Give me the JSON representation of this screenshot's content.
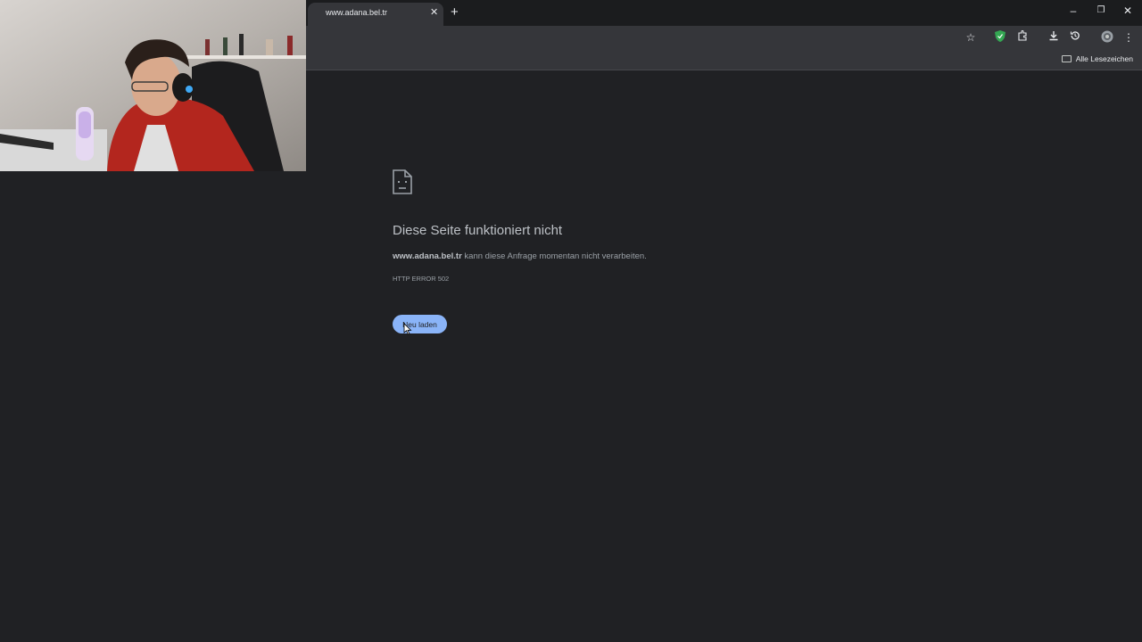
{
  "tab": {
    "title": "www.adana.bel.tr",
    "close_icon": "close-icon"
  },
  "toolbar": {
    "icons": [
      "star-icon",
      "shield-extension-icon",
      "puzzle-icon",
      "download-icon",
      "history-icon",
      "profile-avatar",
      "kebab-menu-icon"
    ]
  },
  "bookmarks": {
    "all_label": "Alle Lesezeichen"
  },
  "error": {
    "title": "Diese Seite funktioniert nicht",
    "host": "www.adana.bel.tr",
    "message": " kann diese Anfrage momentan nicht verarbeiten.",
    "code": "HTTP ERROR 502",
    "reload_label": "Neu laden"
  },
  "colors": {
    "page_bg": "#202124",
    "toolbar_bg": "#35363a",
    "button_bg": "#8ab4f8",
    "shield_green": "#34a853"
  }
}
